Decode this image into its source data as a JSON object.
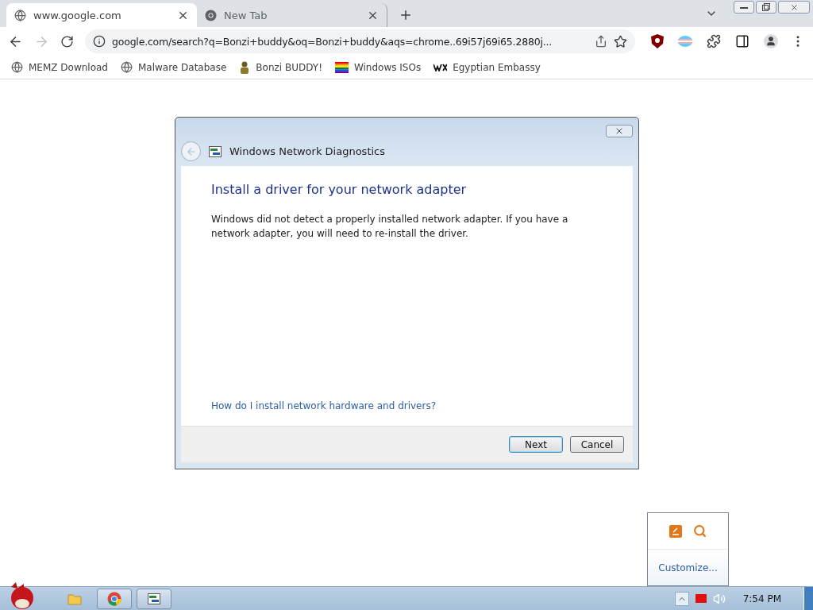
{
  "tabs": [
    {
      "title": "www.google.com",
      "selected": true
    },
    {
      "title": "New Tab",
      "selected": false
    }
  ],
  "address": {
    "url": "google.com/search?q=Bonzi+buddy&oq=Bonzi+buddy&aqs=chrome..69i57j69i65.2880j..."
  },
  "bookmarks": [
    {
      "label": "MEMZ Download"
    },
    {
      "label": "Malware Database"
    },
    {
      "label": "Bonzi BUDDY!"
    },
    {
      "label": "Windows ISOs"
    },
    {
      "label": "Egyptian Embassy"
    }
  ],
  "dialog": {
    "title": "Windows Network Diagnostics",
    "heading": "Install a driver for your network adapter",
    "body": "Windows did not detect a properly installed network adapter. If you have a network adapter, you will need to re-install the driver.",
    "link": "How do I install network hardware and drivers?",
    "buttons": [
      {
        "label": "Next",
        "default": true
      },
      {
        "label": "Cancel",
        "default": false
      }
    ]
  },
  "tray_popup": {
    "customize": "Customize..."
  },
  "taskbar": {
    "clock": "7:54 PM"
  }
}
